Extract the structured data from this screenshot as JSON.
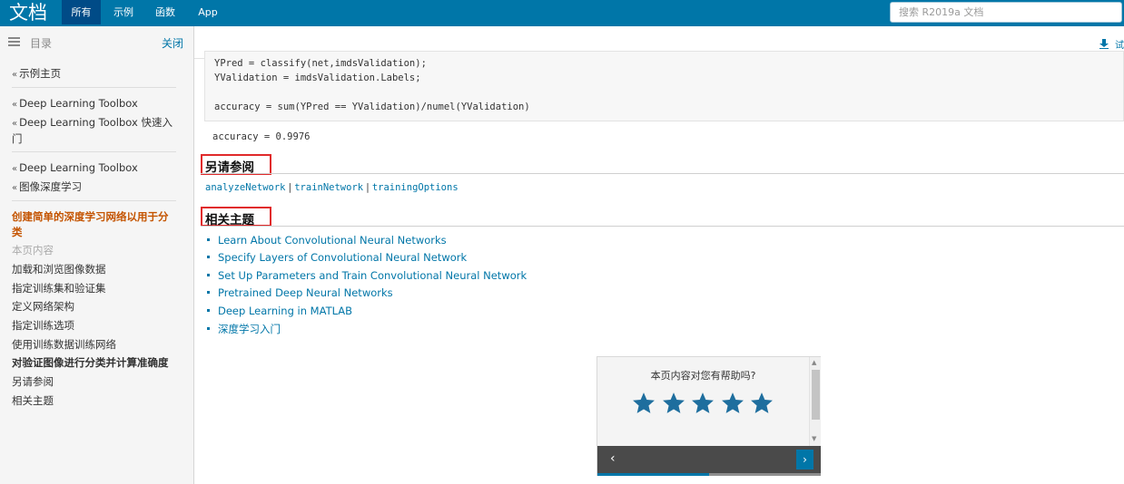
{
  "header": {
    "logo": "文档",
    "tabs": [
      {
        "label": "所有",
        "active": true
      },
      {
        "label": "示例",
        "active": false
      },
      {
        "label": "函数",
        "active": false
      },
      {
        "label": "App",
        "active": false
      }
    ],
    "search_placeholder": "搜索 R2019a 文档"
  },
  "sidebar": {
    "toc_label": "目录",
    "close_label": "关闭",
    "links": [
      "示例主页",
      "Deep Learning Toolbox",
      "Deep Learning Toolbox 快速入门",
      "Deep Learning Toolbox",
      "图像深度学习"
    ],
    "current_page": "创建简单的深度学习网络以用于分类",
    "on_this_page_label": "本页内容",
    "toc_items": [
      {
        "label": "加载和浏览图像数据",
        "bold": false
      },
      {
        "label": "指定训练集和验证集",
        "bold": false
      },
      {
        "label": "定义网络架构",
        "bold": false
      },
      {
        "label": "指定训练选项",
        "bold": false
      },
      {
        "label": "使用训练数据训练网络",
        "bold": false
      },
      {
        "label": "对验证图像进行分类并计算准确度",
        "bold": true
      },
      {
        "label": "另请参阅",
        "bold": false
      },
      {
        "label": "相关主题",
        "bold": false
      }
    ]
  },
  "toolbar": {
    "download_label": "试"
  },
  "content": {
    "code_lines": [
      "YPred = classify(net,imdsValidation);",
      "YValidation = imdsValidation.Labels;",
      "accuracy = sum(YPred == YValidation)/numel(YValidation)"
    ],
    "output": "accuracy = 0.9976",
    "see_also_title": "另请参阅",
    "see_also_links": [
      "analyzeNetwork",
      "trainNetwork",
      "trainingOptions"
    ],
    "see_also_separator": "|",
    "related_title": "相关主题",
    "related_topics": [
      "Learn About Convolutional Neural Networks",
      "Specify Layers of Convolutional Neural Network",
      "Set Up Parameters and Train Convolutional Neural Network",
      "Pretrained Deep Neural Networks",
      "Deep Learning in MATLAB",
      "深度学习入门"
    ]
  },
  "feedback": {
    "question": "本页内容对您有帮助吗?",
    "star_count": 5,
    "star_color": "#1e6e9e",
    "progress": 0.5
  },
  "colors": {
    "brand_blue": "#0076a8",
    "active_tab": "#004b87",
    "highlight_box": "#e0292a",
    "current_page": "#c45400"
  }
}
